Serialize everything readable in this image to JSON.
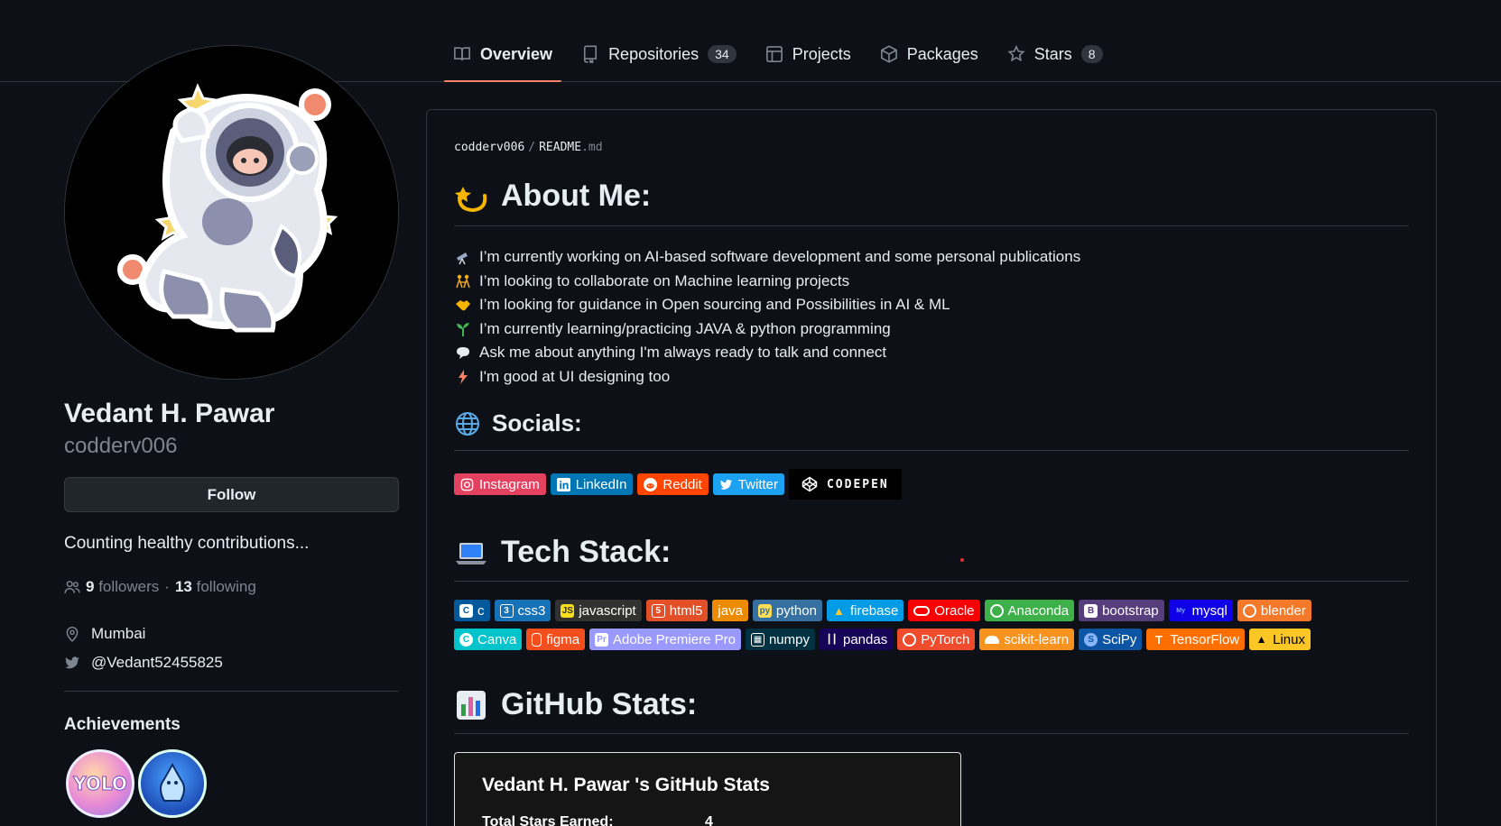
{
  "nav": {
    "tabs": [
      {
        "label": "Overview",
        "icon": "book-icon",
        "active": true
      },
      {
        "label": "Repositories",
        "icon": "repo-icon",
        "count": "34"
      },
      {
        "label": "Projects",
        "icon": "table-icon"
      },
      {
        "label": "Packages",
        "icon": "package-icon"
      },
      {
        "label": "Stars",
        "icon": "star-icon",
        "count": "8"
      }
    ]
  },
  "profile": {
    "name": "Vedant H. Pawar",
    "login": "codderv006",
    "follow_label": "Follow",
    "bio": "Counting healthy contributions...",
    "followers_count": "9",
    "followers_label": "followers",
    "separator": "·",
    "following_count": "13",
    "following_label": "following",
    "location": "Mumbai",
    "twitter": "@Vedant52455825",
    "achievements_title": "Achievements"
  },
  "readme": {
    "crumb_user": "codderv006",
    "crumb_sep": "/",
    "crumb_file": "README",
    "crumb_ext": ".md",
    "about_title": "About Me:",
    "about_items": [
      {
        "icon": "telescope-icon",
        "text": "I’m currently working on AI-based software development and some personal publications"
      },
      {
        "icon": "people-holding-hands-icon",
        "text": "I’m looking to collaborate on Machine learning projects"
      },
      {
        "icon": "handshake-icon",
        "text": "I’m looking for guidance in Open sourcing and Possibilities in AI & ML"
      },
      {
        "icon": "seedling-icon",
        "text": "I’m currently learning/practicing JAVA & python programming"
      },
      {
        "icon": "speech-bubble-icon",
        "text": "Ask me about anything I'm always ready to talk and connect"
      },
      {
        "icon": "lightning-icon",
        "text": "I'm good at UI designing too"
      }
    ],
    "socials_title": "Socials:",
    "socials": [
      {
        "label": "Instagram",
        "color": "#E4405F"
      },
      {
        "label": "LinkedIn",
        "color": "#0077B5"
      },
      {
        "label": "Reddit",
        "color": "#FF4500"
      },
      {
        "label": "Twitter",
        "color": "#1DA1F2"
      }
    ],
    "codepen_label": "CODEPEN",
    "tech_title": "Tech Stack:",
    "tech_row1": [
      {
        "label": "c",
        "color": "#00599C"
      },
      {
        "label": "css3",
        "color": "#1572B6"
      },
      {
        "label": "javascript",
        "color": "#323330"
      },
      {
        "label": "html5",
        "color": "#E34F26"
      },
      {
        "label": "java",
        "color": "#ED8B00"
      },
      {
        "label": "python",
        "color": "#3670A0"
      },
      {
        "label": "firebase",
        "color": "#039BE5"
      },
      {
        "label": "Oracle",
        "color": "#F80000"
      },
      {
        "label": "Anaconda",
        "color": "#3EB049"
      },
      {
        "label": "bootstrap",
        "color": "#563D7C"
      },
      {
        "label": "mysql",
        "color": "#0F00E8"
      },
      {
        "label": "blender",
        "color": "#F5792A"
      }
    ],
    "tech_row2": [
      {
        "label": "Canva",
        "color": "#00C4CC"
      },
      {
        "label": "figma",
        "color": "#F24E1E"
      },
      {
        "label": "Adobe Premiere Pro",
        "color": "#9999FF"
      },
      {
        "label": "numpy",
        "color": "#013243"
      },
      {
        "label": "pandas",
        "color": "#150458"
      },
      {
        "label": "PyTorch",
        "color": "#EE4C2C"
      },
      {
        "label": "scikit-learn",
        "color": "#F7931E"
      },
      {
        "label": "SciPy",
        "color": "#0C55A5"
      },
      {
        "label": "TensorFlow",
        "color": "#FF6F00"
      },
      {
        "label": "Linux",
        "color": "#FCC624"
      }
    ],
    "stats_title": "GitHub Stats:",
    "stats_card_title": "Vedant H. Pawar 's GitHub Stats",
    "stats_stars_label": "Total Stars Earned:",
    "stats_stars_value": "4"
  },
  "colors": {
    "background": "#0d1117",
    "border": "#30363d",
    "muted": "#7d8590",
    "tab_underline": "#f78166"
  }
}
